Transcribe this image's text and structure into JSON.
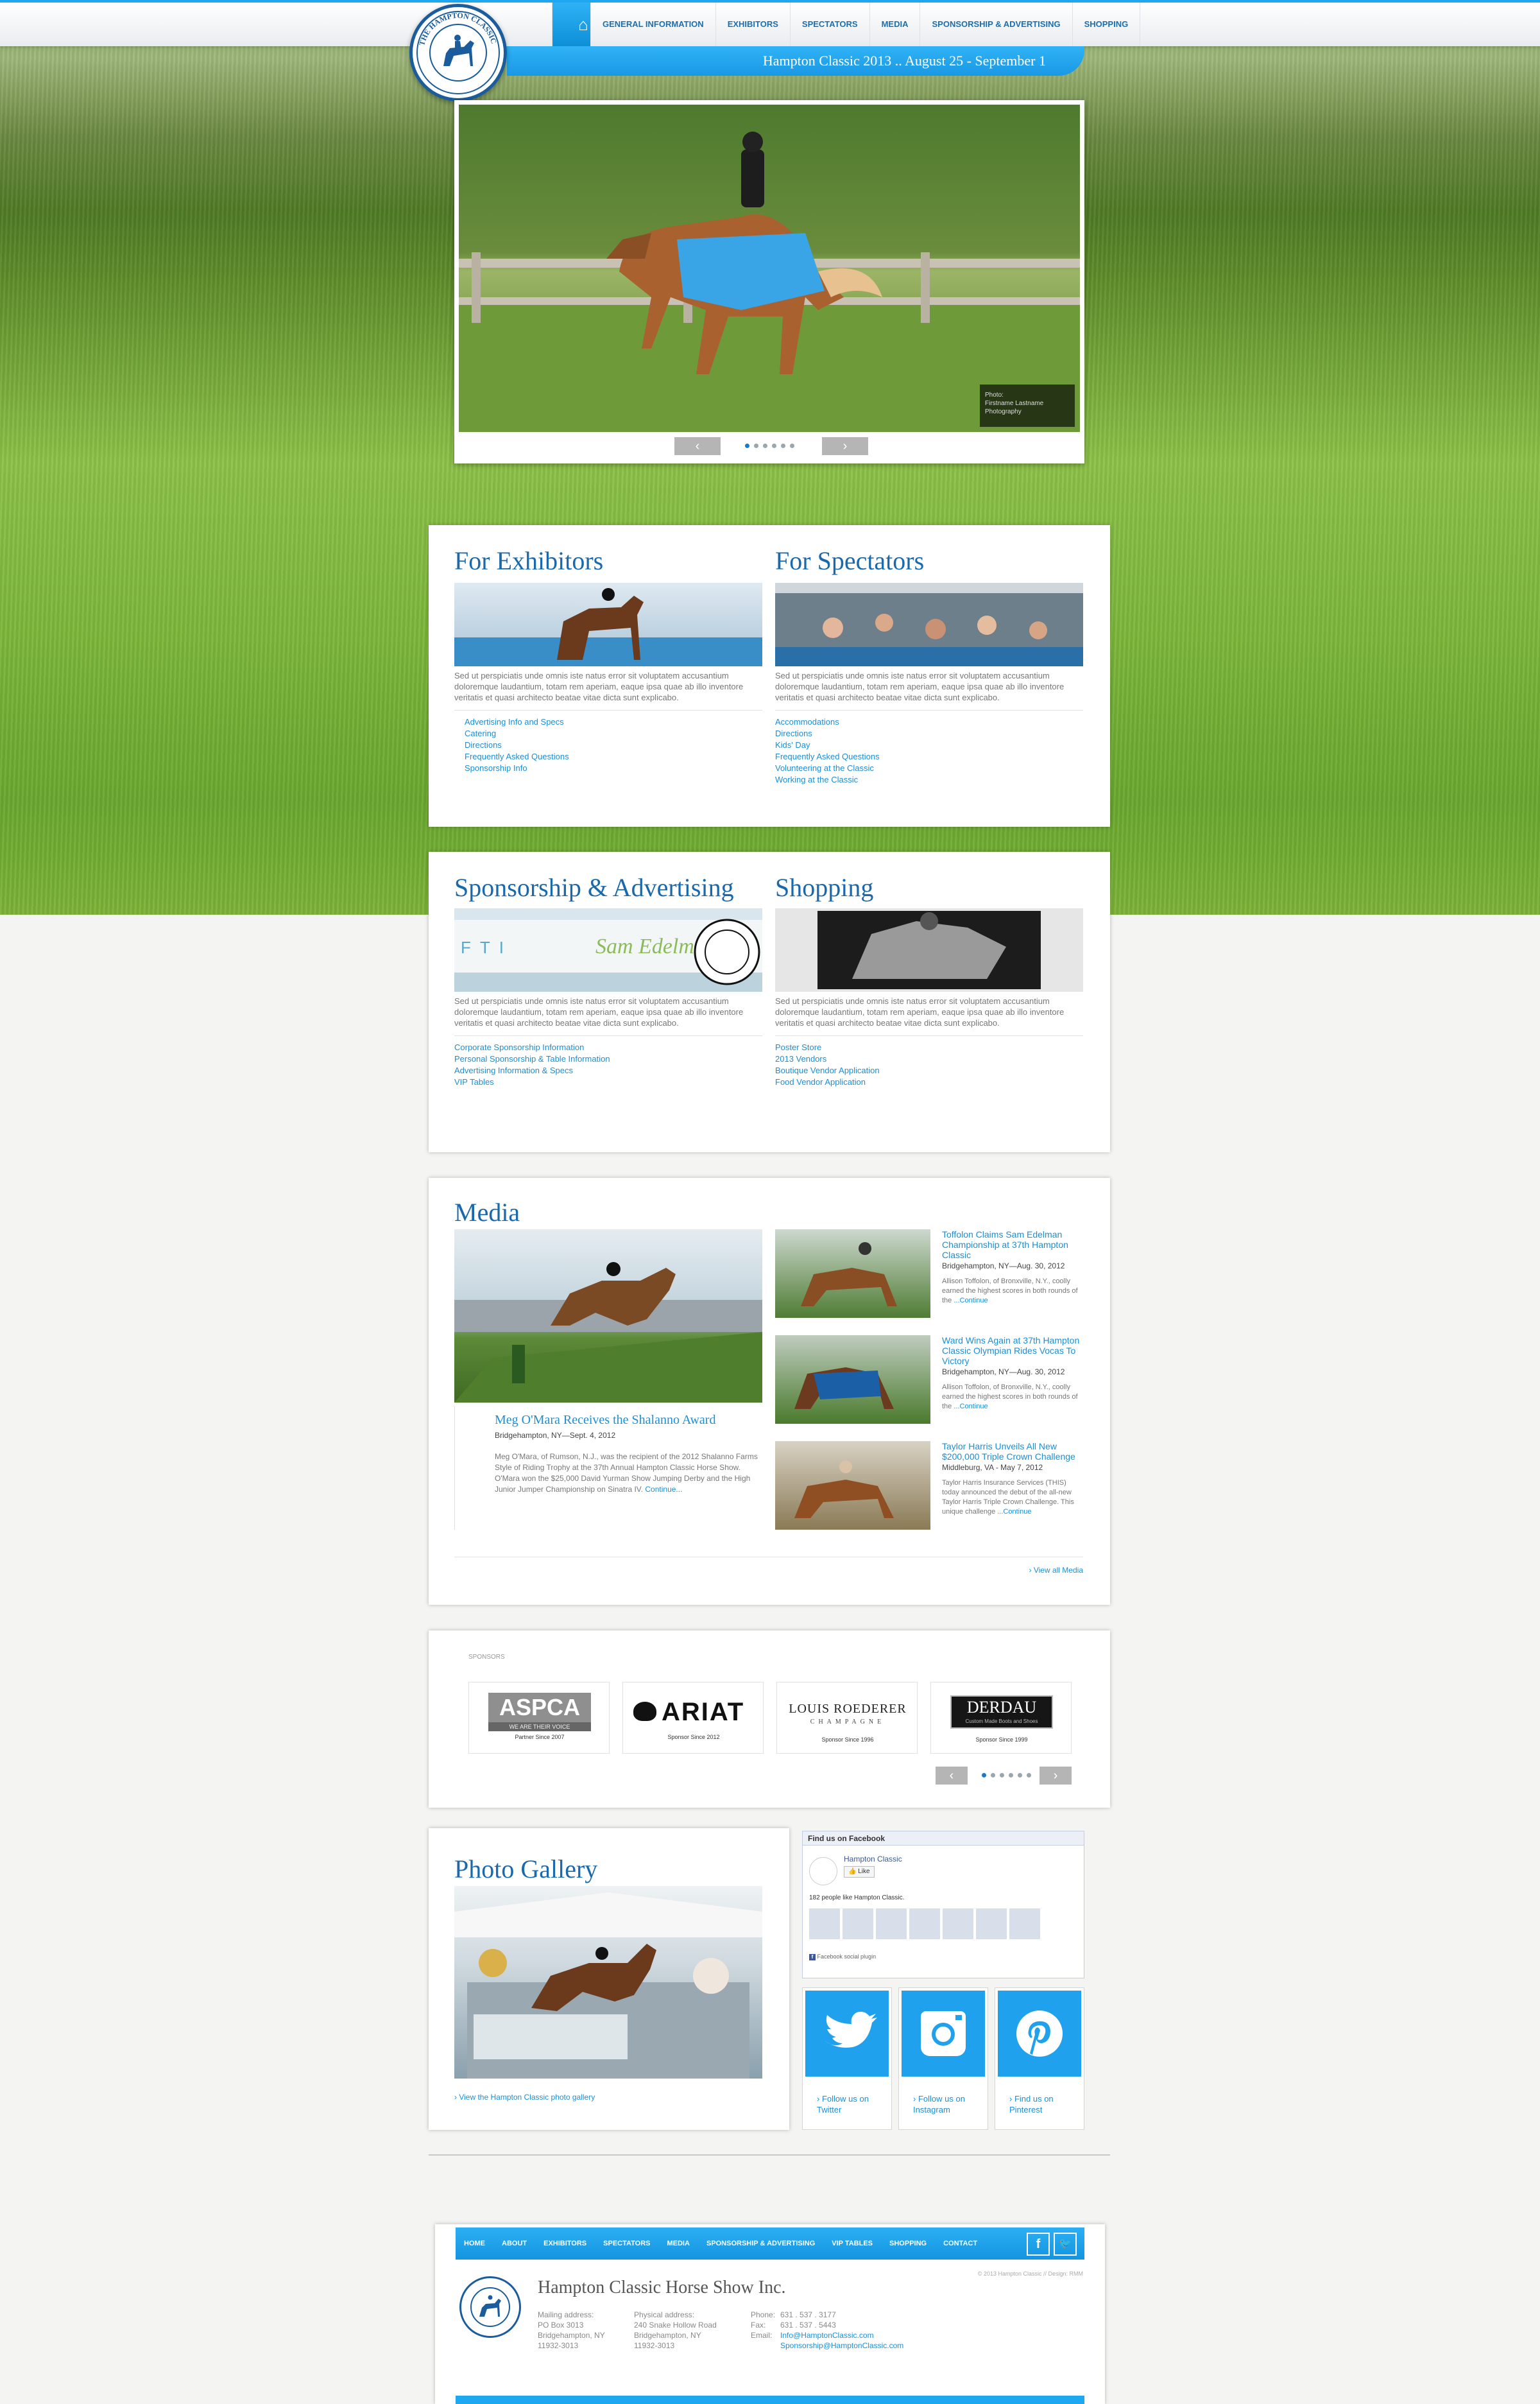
{
  "brand": {
    "logo_text": "THE HAMPTON CLASSIC",
    "accent": "#1ea8f0",
    "navy": "#1b69ad"
  },
  "nav": {
    "home_icon": "home-icon",
    "items": [
      "GENERAL INFORMATION",
      "EXHIBITORS",
      "SPECTATORS",
      "MEDIA",
      "SPONSORSHIP & ADVERTISING",
      "SHOPPING"
    ]
  },
  "event_banner": "Hampton Classic 2013 .. August 25 - September 1",
  "slider": {
    "caption_line1": "Photo:",
    "caption_line2": "Firstname Lastname",
    "caption_line3": "Photography",
    "prev_icon": "chevron-left-icon",
    "next_icon": "chevron-right-icon"
  },
  "lorem": "Sed ut perspiciatis unde omnis iste natus error sit voluptatem accusantium doloremque laudantium, totam rem aperiam, eaque ipsa quae ab illo inventore veritatis et quasi architecto beatae vitae dicta sunt explicabo.",
  "exhibitors": {
    "title": "For Exhibitors",
    "links": [
      "Advertising Info and Specs",
      "Catering",
      "Directions",
      "Frequently Asked Questions",
      "Sponsorship Info"
    ]
  },
  "spectators": {
    "title": "For Spectators",
    "links": [
      "Accommodations",
      "Directions",
      "Kids' Day",
      "Frequently Asked Questions",
      "Volunteering at the Classic",
      "Working at the Classic"
    ]
  },
  "sponsorship": {
    "title": "Sponsorship & Advertising",
    "links": [
      "Corporate Sponsorship Information",
      "Personal Sponsorship & Table Information",
      "Advertising Information & Specs",
      "VIP Tables"
    ]
  },
  "shopping": {
    "title": "Shopping",
    "links": [
      "Poster Store",
      "2013 Vendors",
      "Boutique Vendor Application",
      "Food Vendor Application"
    ]
  },
  "media": {
    "title": "Media",
    "feature": {
      "title": "Meg O'Mara Receives the Shalanno Award",
      "date": "Bridgehampton, NY—Sept. 4, 2012",
      "body": "Meg O'Mara, of Rumson, N.J., was the recipient of the 2012 Shalanno Farms Style of Riding Trophy at the 37th Annual Hampton Classic Horse Show. O'Mara won the $25,000 David Yurman Show Jumping Derby and the High Junior Jumper Championship on Sinatra IV.",
      "more": "Continue..."
    },
    "items": [
      {
        "title": "Toffolon Claims Sam Edelman Championship at 37th Hampton Classic",
        "date": "Bridgehampton, NY—Aug. 30, 2012",
        "body": "Allison Toffolon, of Bronxville, N.Y., coolly earned the highest scores in both rounds of the ",
        "more": "...Continue"
      },
      {
        "title": "Ward Wins Again at 37th Hampton Classic Olympian Rides Vocas To Victory",
        "date": "Bridgehampton, NY—Aug. 30, 2012",
        "body": "Allison Toffolon, of Bronxville, N.Y., coolly earned the highest scores in both rounds of the ",
        "more": "...Continue"
      },
      {
        "title": "Taylor Harris Unveils All New $200,000 Triple Crown Challenge",
        "date": "Middleburg, VA - May 7, 2012",
        "body": "Taylor Harris Insurance Services (THIS) today announced the debut of the all-new Taylor Harris Triple Crown Challenge. This unique challenge ",
        "more": "...Continue"
      }
    ],
    "view_all": "View all Media"
  },
  "sponsors": {
    "label": "SPONSORS",
    "items": [
      {
        "name": "ASPCA",
        "tag": "WE ARE THEIR VOICE",
        "since": "Partner Since 2007"
      },
      {
        "name": "ARIAT",
        "tag": "",
        "since": "Sponsor Since 2012"
      },
      {
        "name": "LOUIS ROEDERER",
        "tag": "CHAMPAGNE",
        "since": "Sponsor Since 1996"
      },
      {
        "name": "DERDAU",
        "tag": "Custom Made Boots and Shoes",
        "since": "Sponsor Since 1999"
      }
    ]
  },
  "gallery": {
    "title": "Photo Gallery",
    "link": "View the Hampton Classic photo gallery"
  },
  "facebook": {
    "header": "Find us on Facebook",
    "page": "Hampton Classic",
    "like": "Like",
    "count": "182 people like Hampton Classic.",
    "plugin": "Facebook social plugin"
  },
  "social": [
    {
      "icon": "twitter-icon",
      "label1": "Follow us on",
      "label2": "Twitter"
    },
    {
      "icon": "instagram-icon",
      "label1": "Follow us on",
      "label2": "Instagram"
    },
    {
      "icon": "pinterest-icon",
      "label1": "Find us on",
      "label2": "Pinterest"
    }
  ],
  "footer": {
    "nav": [
      "HOME",
      "ABOUT",
      "EXHIBITORS",
      "SPECTATORS",
      "MEDIA",
      "SPONSORSHIP & ADVERTISING",
      "VIP TABLES",
      "SHOPPING",
      "CONTACT"
    ],
    "copyright": "© 2013 Hampton Classic  //  Design: RMM",
    "org": "Hampton Classic Horse Show Inc.",
    "mailing": [
      "Mailing address:",
      "PO Box 3013",
      "Bridgehampton, NY",
      "11932-3013"
    ],
    "physical": [
      "Physical address:",
      "240 Snake Hollow Road",
      "Bridgehampton, NY",
      "11932-3013"
    ],
    "phone_label": "Phone:",
    "phone": "631 . 537 . 3177",
    "fax_label": "Fax:",
    "fax": "631 . 537 . 5443",
    "email_label": "Email:",
    "email1": "Info@HamptonClassic.com",
    "email2": "Sponsorship@HamptonClassic.com"
  }
}
